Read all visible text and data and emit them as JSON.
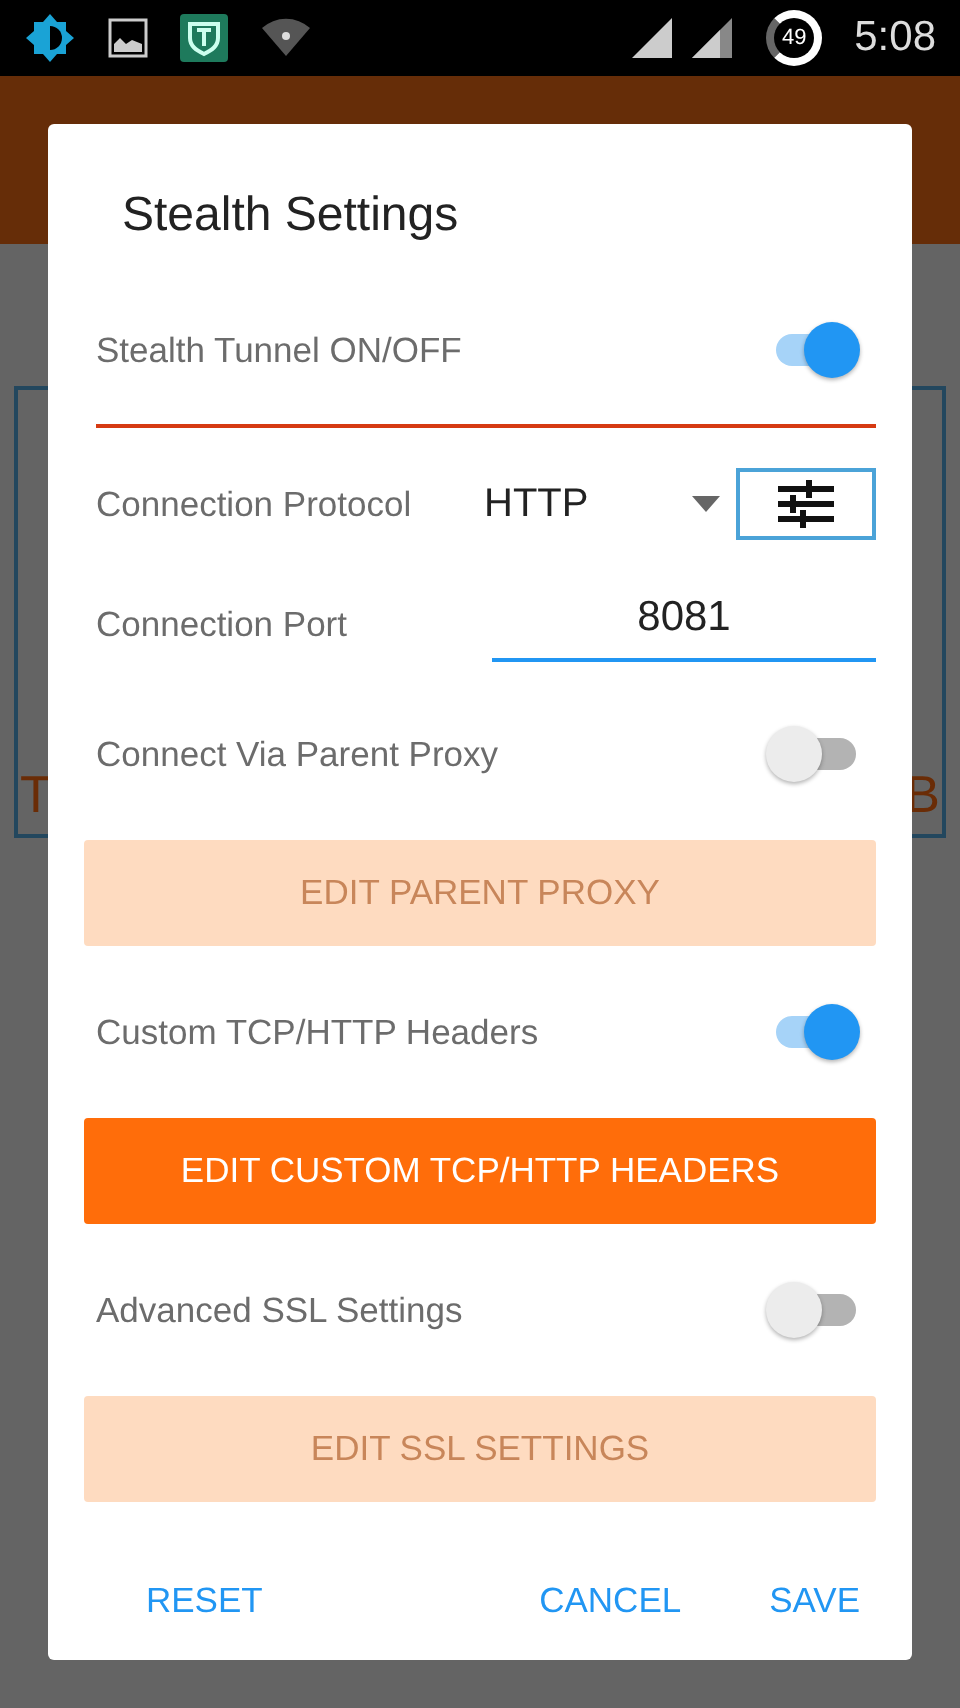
{
  "status_bar": {
    "battery": "49",
    "time": "5:08"
  },
  "background": {
    "fragments": [
      "T",
      "B"
    ]
  },
  "dialog": {
    "title": "Stealth Settings",
    "rows": [
      {
        "kind": "toggle",
        "label": "Stealth Tunnel ON/OFF",
        "on": true,
        "underline": true
      },
      {
        "kind": "select",
        "label": "Connection Protocol",
        "value": "HTTP"
      },
      {
        "kind": "field",
        "label": "Connection Port",
        "value": "8081"
      },
      {
        "kind": "toggle",
        "label": "Connect Via Parent Proxy",
        "on": false
      },
      {
        "kind": "button",
        "label": "EDIT PARENT PROXY",
        "disabled": true
      },
      {
        "kind": "toggle",
        "label": "Custom TCP/HTTP Headers",
        "on": true
      },
      {
        "kind": "button",
        "label": "EDIT CUSTOM TCP/HTTP HEADERS",
        "disabled": false
      },
      {
        "kind": "toggle",
        "label": "Advanced SSL Settings",
        "on": false
      },
      {
        "kind": "button",
        "label": "EDIT SSL SETTINGS",
        "disabled": true
      }
    ],
    "actions": [
      "RESET",
      "CANCEL",
      "SAVE"
    ]
  }
}
